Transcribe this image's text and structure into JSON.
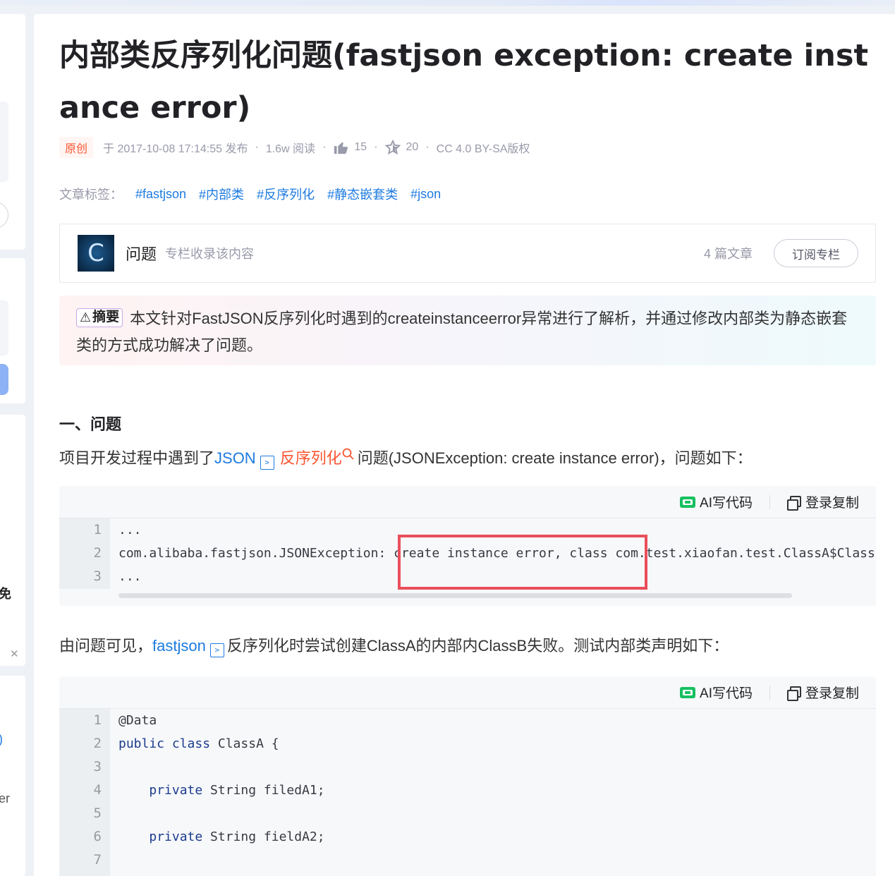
{
  "article": {
    "title": "内部类反序列化问题(fastjson exception: create instance error)",
    "meta": {
      "type_badge": "原创",
      "published": "于 2017-10-08 17:14:55 发布",
      "reads": "1.6w 阅读",
      "likes": "15",
      "favorites": "20",
      "license": "CC 4.0 BY-SA版权"
    },
    "tags_label": "文章标签：",
    "tags": [
      "#fastjson",
      "#内部类",
      "#反序列化",
      "#静态嵌套类",
      "#json"
    ],
    "column": {
      "logo_letter": "C",
      "name": "问题",
      "desc": "专栏收录该内容",
      "count": "4 篇文章",
      "subscribe": "订阅专栏"
    },
    "summary": {
      "badge": "摘要",
      "text": "本文针对FastJSON反序列化时遇到的createinstanceerror异常进行了解析，并通过修改内部类为静态嵌套类的方式成功解决了问题。"
    },
    "section1": {
      "heading": "一、问题",
      "p1_a": "项目开发过程中遇到了",
      "p1_link": "JSON",
      "p1_red": "反序列化",
      "p1_b": "问题(JSONException: create instance error)，问题如下：",
      "p2_a": "由问题可见，",
      "p2_link": "fastjson",
      "p2_b": "反序列化时尝试创建ClassA的内部内ClassB失败。测试内部类声明如下："
    },
    "code_toolbar": {
      "ai": "AI写代码",
      "copy": "登录复制"
    },
    "code1": {
      "numbers": [
        "1",
        "2",
        "3"
      ],
      "lines": [
        "...",
        "com.alibaba.fastjson.JSONException: create instance error, class com.test.xiaofan.test.ClassA$ClassB",
        "..."
      ]
    },
    "code2": {
      "numbers": [
        "1",
        "2",
        "3",
        "4",
        "5",
        "6",
        "7"
      ],
      "l1": "@Data",
      "l2_kw": "public class",
      "l2_rest": " ClassA {",
      "l4_kw": "private",
      "l4_rest": " String filedA1;",
      "l6_kw": "private",
      "l6_rest": " String fieldA2;"
    }
  },
  "left_rail": {
    "fragment1": "免",
    "fragment2": "er"
  },
  "colors": {
    "link": "#1d7be0",
    "accent": "#fc5531",
    "highlight_box": "#ea4f5b"
  }
}
